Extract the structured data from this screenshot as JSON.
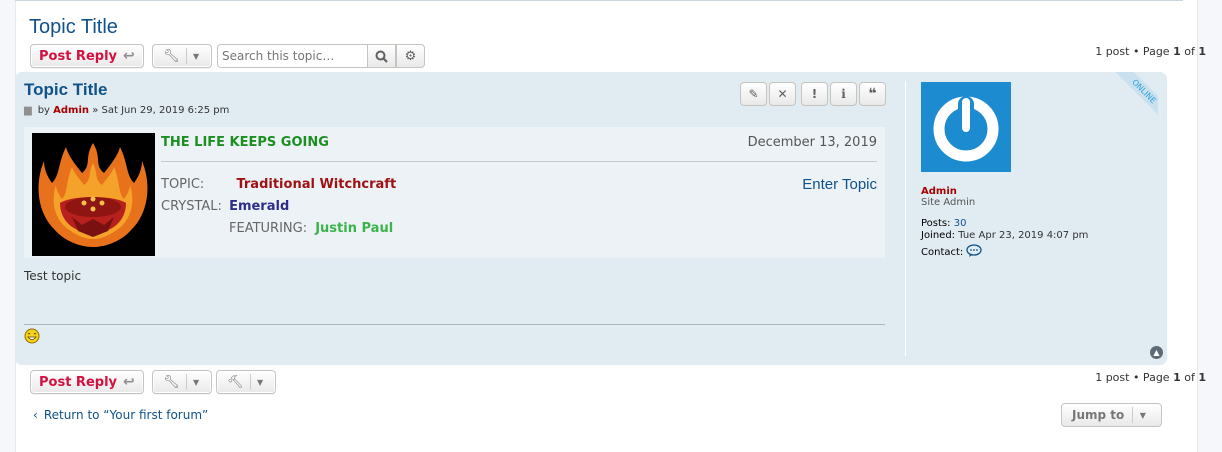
{
  "topic": {
    "title": "Topic Title"
  },
  "toolbar": {
    "post_reply_label": "Post Reply",
    "reply_icon": "reply-icon",
    "tools_icon": "wrench-icon",
    "mod_icon": "gavel-icon",
    "search_placeholder": "Search this topic…",
    "search_icon": "search-icon",
    "advanced_search_icon": "gear-icon"
  },
  "pagination": {
    "posts_text": "1 post • Page",
    "current_page": "1",
    "of_text": "of",
    "total_pages": "1"
  },
  "post": {
    "title": "Topic Title",
    "meta": {
      "by_text": "by",
      "author": "Admin",
      "separator": "»",
      "date": "Sat Jun 29, 2019 6:25 pm"
    },
    "actions": [
      {
        "name": "edit",
        "icon": "pencil-icon",
        "glyph": "✎"
      },
      {
        "name": "delete",
        "icon": "close-icon",
        "glyph": "✕"
      },
      {
        "name": "report",
        "icon": "exclamation-icon",
        "glyph": "!"
      },
      {
        "name": "info",
        "icon": "info-icon",
        "glyph": "i"
      },
      {
        "name": "quote",
        "icon": "quote-icon",
        "glyph": "❝"
      }
    ],
    "banner": {
      "heading": "THE LIFE KEEPS GOING",
      "date": "December 13, 2019",
      "topic_label": "TOPIC:",
      "topic_value": "Traditional Witchcraft",
      "crystal_label": "CRYSTAL:",
      "crystal_value": "Emerald",
      "featuring_label": "FEATURING:",
      "featuring_value": "Justin Paul",
      "enter_link": "Enter Topic",
      "colors": {
        "heading": "#1c8f21",
        "topic": "#9e1111",
        "crystal": "#2e2e8a",
        "featuring": "#3cb34a"
      }
    },
    "content": "Test topic",
    "signature_icon": "laughing-smiley-icon"
  },
  "profile": {
    "status_ribbon": "ONLINE",
    "username": "Admin",
    "rank": "Site Admin",
    "posts_label": "Posts:",
    "posts_value": "30",
    "joined_label": "Joined:",
    "joined_value": "Tue Apr 23, 2019 4:07 pm",
    "contact_label": "Contact:",
    "contact_icon": "speech-bubble-icon"
  },
  "footer": {
    "return_link": "Return to “Your first forum”",
    "jump_to_label": "Jump to"
  },
  "colors": {
    "link_blue": "#105289",
    "post_reply_red": "#d31141",
    "author_red": "#aa0000",
    "post_bg": "#e1ebf2",
    "avatar_blue": "#1d8bd0"
  }
}
